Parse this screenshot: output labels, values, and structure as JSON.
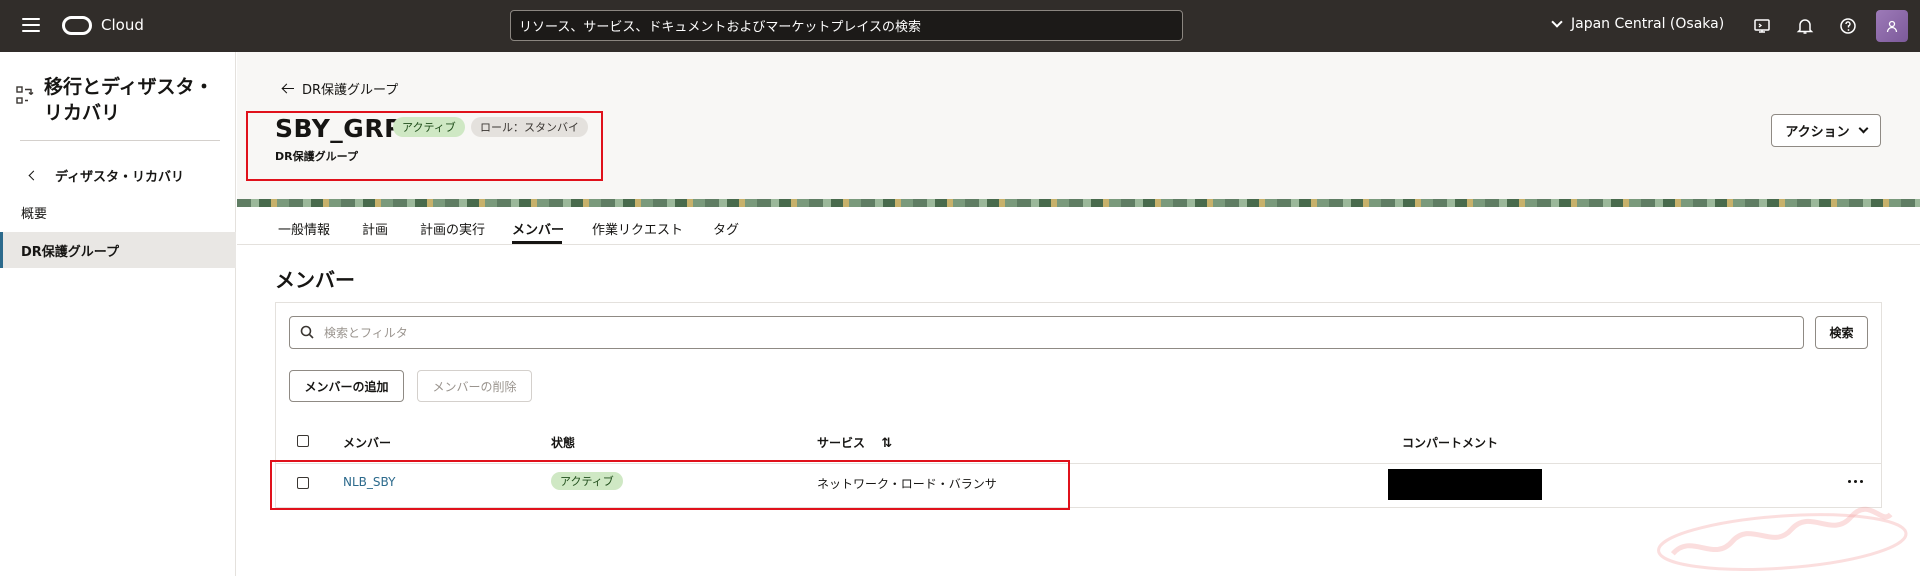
{
  "topbar": {
    "brand": "Cloud",
    "search_text": "リソース、サービス、ドキュメントおよびマーケットプレイスの検索",
    "region": "Japan Central (Osaka)"
  },
  "sidebar": {
    "title": "移行とディザスタ・リカバリ",
    "back_label": "ディザスタ・リカバリ",
    "items": [
      {
        "label": "概要"
      },
      {
        "label": "DR保護グループ"
      }
    ]
  },
  "header": {
    "back_link": "DR保護グループ",
    "title": "SBY_GRP",
    "badge_status": "アクティブ",
    "badge_role": "ロール：スタンバイ",
    "subtitle": "DR保護グループ",
    "action_label": "アクション"
  },
  "tabs": [
    {
      "label": "一般情報"
    },
    {
      "label": "計画"
    },
    {
      "label": "計画の実行"
    },
    {
      "label": "メンバー"
    },
    {
      "label": "作業リクエスト"
    },
    {
      "label": "タグ"
    }
  ],
  "members": {
    "title": "メンバー",
    "filter_placeholder": "検索とフィルタ",
    "search_button": "検索",
    "add_button": "メンバーの追加",
    "delete_button": "メンバーの削除",
    "columns": [
      "メンバー",
      "状態",
      "サービス",
      "コンパートメント"
    ],
    "rows": [
      {
        "member": "NLB_SBY",
        "status": "アクティブ",
        "service": "ネットワーク・ロード・バランサ"
      }
    ]
  },
  "colors": {
    "topbar_bg": "#312d2a",
    "accent_link": "#2c6a8c",
    "status_green": "#cfe8c4",
    "highlight_red": "#e0111b"
  }
}
